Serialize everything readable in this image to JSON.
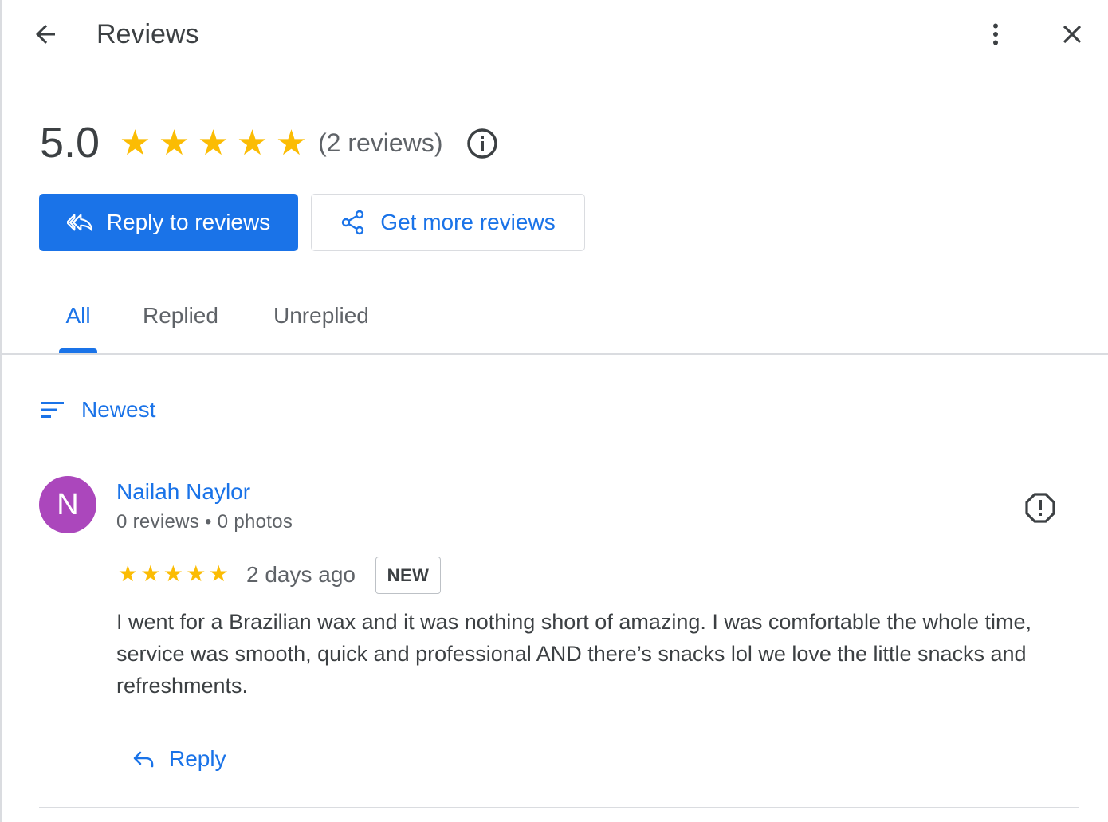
{
  "header": {
    "title": "Reviews",
    "back_icon": "arrow-back-icon",
    "more_icon": "more-vert-icon",
    "close_icon": "close-icon"
  },
  "summary": {
    "rating": "5.0",
    "stars": 5,
    "count_text": "(2 reviews)",
    "info_icon": "info-icon"
  },
  "actions": {
    "reply_label": "Reply to reviews",
    "reply_icon": "reply-all-icon",
    "get_more_label": "Get more reviews",
    "get_more_icon": "share-icon"
  },
  "tabs": [
    {
      "label": "All",
      "selected": true
    },
    {
      "label": "Replied",
      "selected": false
    },
    {
      "label": "Unreplied",
      "selected": false
    }
  ],
  "sort": {
    "label": "Newest",
    "icon": "sort-icon"
  },
  "reviews": [
    {
      "avatar_letter": "N",
      "avatar_color": "#ab47bc",
      "name": "Nailah Naylor",
      "meta": "0 reviews • 0 photos",
      "stars": 5,
      "date": "2 days ago",
      "badge": "NEW",
      "text": "I went for a Brazilian wax and it was nothing short of amazing. I was comfortable the whole time, service was smooth, quick and professional AND there’s snacks lol we love the little snacks and refreshments.",
      "reply_label": "Reply",
      "flag_icon": "report-icon"
    }
  ],
  "colors": {
    "accent": "#1a73e8",
    "star": "#fbbc04",
    "text": "#3c4043",
    "muted": "#5f6368",
    "divider": "#dadce0"
  }
}
